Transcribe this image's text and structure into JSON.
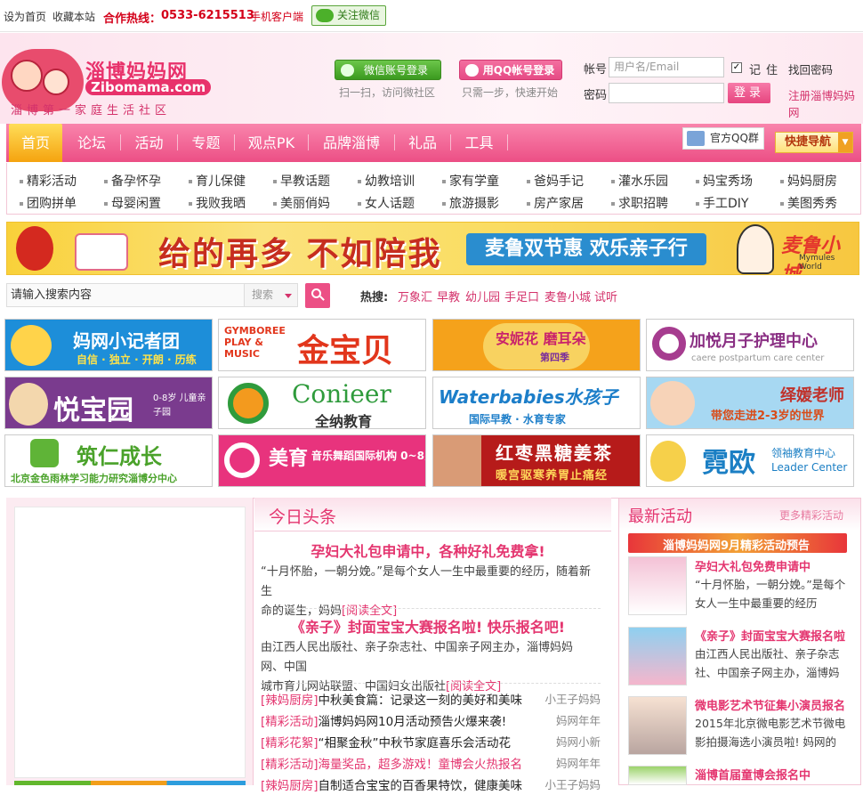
{
  "topbar": {
    "set_home": "设为首页",
    "bookmark": "收藏本站",
    "hotline_label": "合作热线：",
    "hotline_number": "0533-6215513",
    "mobile": "手机客户端",
    "follow_wechat": "关注微信"
  },
  "logo": {
    "title": "淄博妈妈网",
    "url": "Zibomama.com",
    "slogan": "淄博第一家庭生活社区"
  },
  "login": {
    "wechat_login": "微信账号登录",
    "wechat_hint": "扫一扫，访问微社区",
    "qq_login": "用QQ帐号登录",
    "qq_hint": "只需一步，快速开始",
    "account_label": "帐号",
    "account_placeholder": "用户名/Email",
    "password_label": "密码",
    "remember": "记住",
    "find_password": "找回密码",
    "login_button": "登录",
    "register": "注册淄博妈妈网"
  },
  "nav": {
    "items": [
      "首页",
      "论坛",
      "活动",
      "专题",
      "观点PK",
      "品牌淄博",
      "礼品",
      "工具"
    ],
    "qq_group": "官方QQ群",
    "quick_nav": "快捷导航"
  },
  "subnav": {
    "row1": [
      "精彩活动",
      "备孕怀孕",
      "育儿保健",
      "早教话题",
      "幼教培训",
      "家有学童",
      "爸妈手记",
      "灌水乐园",
      "妈宝秀场",
      "妈妈厨房"
    ],
    "row2": [
      "团购拼单",
      "母婴闲置",
      "我败我晒",
      "美丽俏妈",
      "女人话题",
      "旅游摄影",
      "房产家居",
      "求职招聘",
      "手工DIY",
      "美图秀秀"
    ]
  },
  "banner": {
    "main_text": "给的再多 不如陪我",
    "sub_text": "麦鲁双节惠 欢乐亲子行",
    "brand": "麦鲁小城",
    "brand_en": "Mymules World"
  },
  "search": {
    "placeholder": "请输入搜索内容",
    "type": "搜索",
    "hot_label": "热搜:",
    "hot_keywords": [
      "万象汇",
      "早教",
      "幼儿园",
      "手足口",
      "麦鲁小城",
      "试听"
    ]
  },
  "ads": [
    {
      "title": "妈网小记者团",
      "sub": "自信 · 独立 · 开朗 · 历练"
    },
    {
      "title": "金宝贝",
      "sub": "GYMBOREE PLAY & MUSIC"
    },
    {
      "title": "安妮花 磨耳朵",
      "sub": "第四季"
    },
    {
      "title": "加悦月子护理中心",
      "sub": "caere postpartum care center"
    },
    {
      "title": "悦宝园",
      "sub": "0-8岁 儿童亲子园"
    },
    {
      "title": "Conieer",
      "sub": "全纳教育"
    },
    {
      "title": "Waterbabies水孩子",
      "sub": "国际早教 · 水育专家"
    },
    {
      "title": "绎媛老师",
      "sub": "带您走进2-3岁的世界"
    },
    {
      "title": "筑仁成长",
      "sub": "北京金色雨林学习能力研究淄博分中心"
    },
    {
      "title": "美育",
      "sub": "音乐舞蹈国际机构 0~8岁"
    },
    {
      "title": "红枣黑糖姜茶",
      "sub": "暖宫驱寒养胃止痛经"
    },
    {
      "title": "霓欧",
      "sub": "领袖教育中心 Leader Center"
    }
  ],
  "headlines": {
    "title": "今日头条",
    "stories": [
      {
        "title": "孕妇大礼包申请中，各种好礼免费拿!",
        "line1": "“十月怀胎，一朝分娩。”是每个女人一生中最重要的经历，随着新生",
        "line2": "命的诞生，妈妈",
        "more": "[阅读全文]"
      },
      {
        "title": "《亲子》封面宝宝大赛报名啦! 快乐报名吧!",
        "line1": "由江西人民出版社、亲子杂志社、中国亲子网主办，淄博妈妈网、中国",
        "line2": "城市育儿网站联盟、中国妇女出版社",
        "more": "[阅读全文]"
      }
    ],
    "news": [
      {
        "cat": "[辣妈厨房]",
        "title": "中秋美食篇：记录这一刻的美好和美味",
        "src": "小王子妈妈"
      },
      {
        "cat": "[精彩活动]",
        "title": "淄博妈妈网10月活动预告火爆来袭!",
        "src": "妈网年年"
      },
      {
        "cat": "[精彩花絮]",
        "title": "“相聚金秋”中秋节家庭喜乐会活动花",
        "src": "妈网小新"
      },
      {
        "cat": "[精彩活动]",
        "title": "海量奖品，超多游戏！童博会火热报名",
        "src": "妈网年年"
      },
      {
        "cat": "[辣妈厨房]",
        "title": "自制适合宝宝的百香果特饮，健康美味",
        "src": "小王子妈妈"
      }
    ]
  },
  "activities": {
    "title": "最新活动",
    "more": "更多精彩活动",
    "promo": "淄博妈妈网9月精彩活动预告",
    "items": [
      {
        "title": "孕妇大礼包免费申请中",
        "desc": "“十月怀胎，一朝分娩。”是每个女人一生中最重要的经历"
      },
      {
        "title": "《亲子》封面宝宝大赛报名啦",
        "desc": "由江西人民出版社、亲子杂志社、中国亲子网主办，淄博妈"
      },
      {
        "title": "微电影艺术节征集小演员报名",
        "desc": "2015年北京微电影艺术节微电影拍摄海选小演员啦! 妈网的"
      },
      {
        "title": "淄博首届童博会报名中",
        "desc": ""
      }
    ]
  },
  "colors": {
    "brand_pink": "#ec4f85",
    "accent_red": "#d4001a",
    "nav_active": "#f5a30f"
  }
}
